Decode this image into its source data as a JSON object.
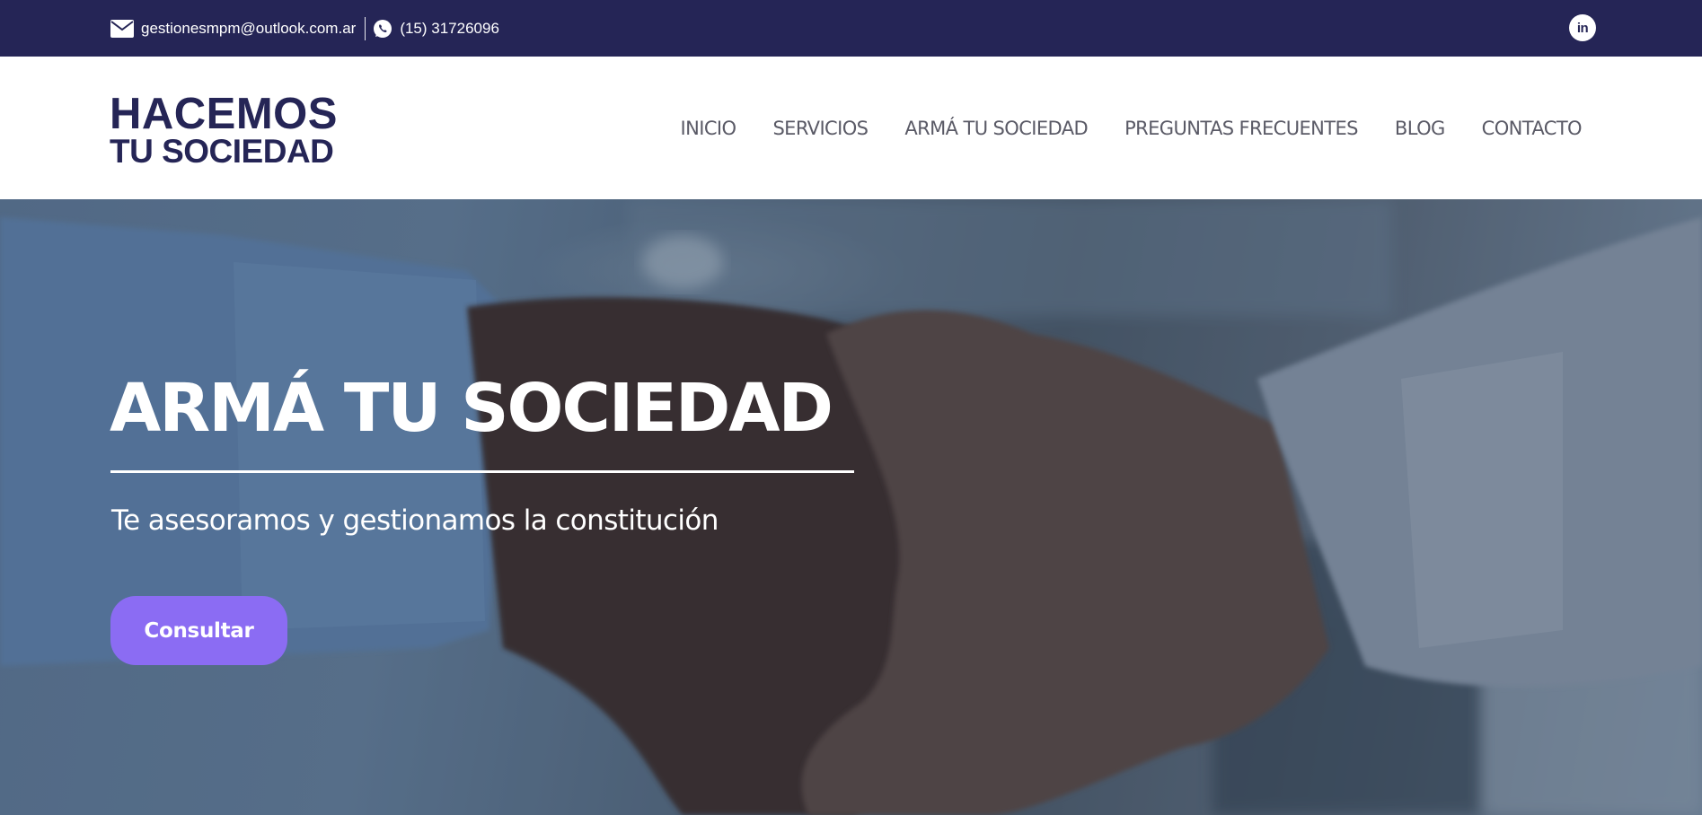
{
  "topbar": {
    "email": "gestionesmpm@outlook.com.ar",
    "phone": "(15) 31726096",
    "icons": {
      "email": "envelope-icon",
      "phone": "whatsapp-icon",
      "social": "linkedin-icon"
    },
    "linkedin_glyph": "in"
  },
  "logo": {
    "line1": "HACEMOS",
    "line2": "TU SOCIEDAD"
  },
  "nav": {
    "items": [
      {
        "label": "INICIO"
      },
      {
        "label": "SERVICIOS"
      },
      {
        "label": "ARMÁ TU SOCIEDAD"
      },
      {
        "label": "PREGUNTAS FRECUENTES"
      },
      {
        "label": "BLOG"
      },
      {
        "label": "CONTACTO"
      }
    ]
  },
  "hero": {
    "title": "ARMÁ TU SOCIEDAD",
    "subtitle": "Te asesoramos y gestionamos la constitución",
    "cta_label": "Consultar"
  },
  "colors": {
    "brand_navy": "#252556",
    "cta_purple": "#8b6cf3",
    "nav_text": "#5a5a66"
  }
}
